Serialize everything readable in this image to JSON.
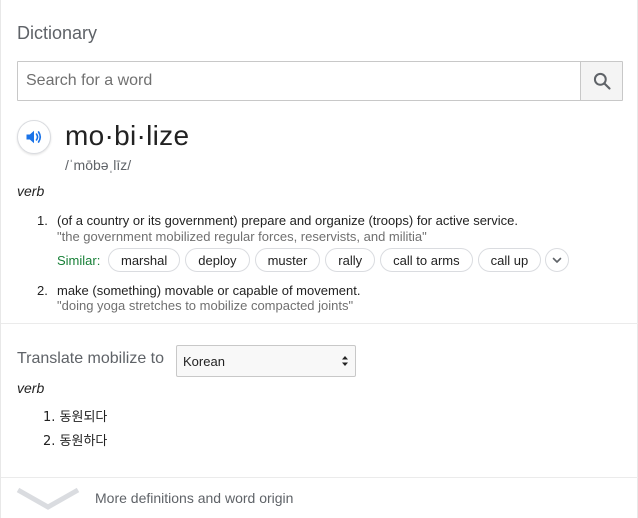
{
  "dictionary": {
    "title": "Dictionary",
    "search": {
      "placeholder": "Search for a word",
      "value": "",
      "button_icon": "search-icon"
    }
  },
  "entry": {
    "speaker_icon": "speaker-icon",
    "headword": "mo·bi·lize",
    "phonetic": "/ˈmōbəˌlīz/",
    "part_of_speech": "verb",
    "definitions": [
      {
        "number": "1.",
        "text": "(of a country or its government) prepare and organize (troops) for active service.",
        "example": "\"the government mobilized regular forces, reservists, and militia\"",
        "similar_label": "Similar:",
        "similar": [
          "marshal",
          "deploy",
          "muster",
          "rally",
          "call to arms",
          "call up"
        ],
        "expand_icon": "chevron-down-icon"
      },
      {
        "number": "2.",
        "text": "make (something) movable or capable of movement.",
        "example": "\"doing yoga stretches to mobilize compacted joints\""
      }
    ]
  },
  "translate": {
    "label": "Translate mobilize to",
    "selected_language": "Korean",
    "part_of_speech": "verb",
    "translations": [
      {
        "number": "1.",
        "text": "동원되다"
      },
      {
        "number": "2.",
        "text": "동원하다"
      }
    ]
  },
  "footer": {
    "more_label": "More definitions and word origin",
    "chevron_icon": "chevron-down-icon"
  },
  "colors": {
    "accent_blue": "#1a73e8",
    "similar_green": "#188038",
    "muted_gray": "#5f6368",
    "example_gray": "#707070"
  }
}
